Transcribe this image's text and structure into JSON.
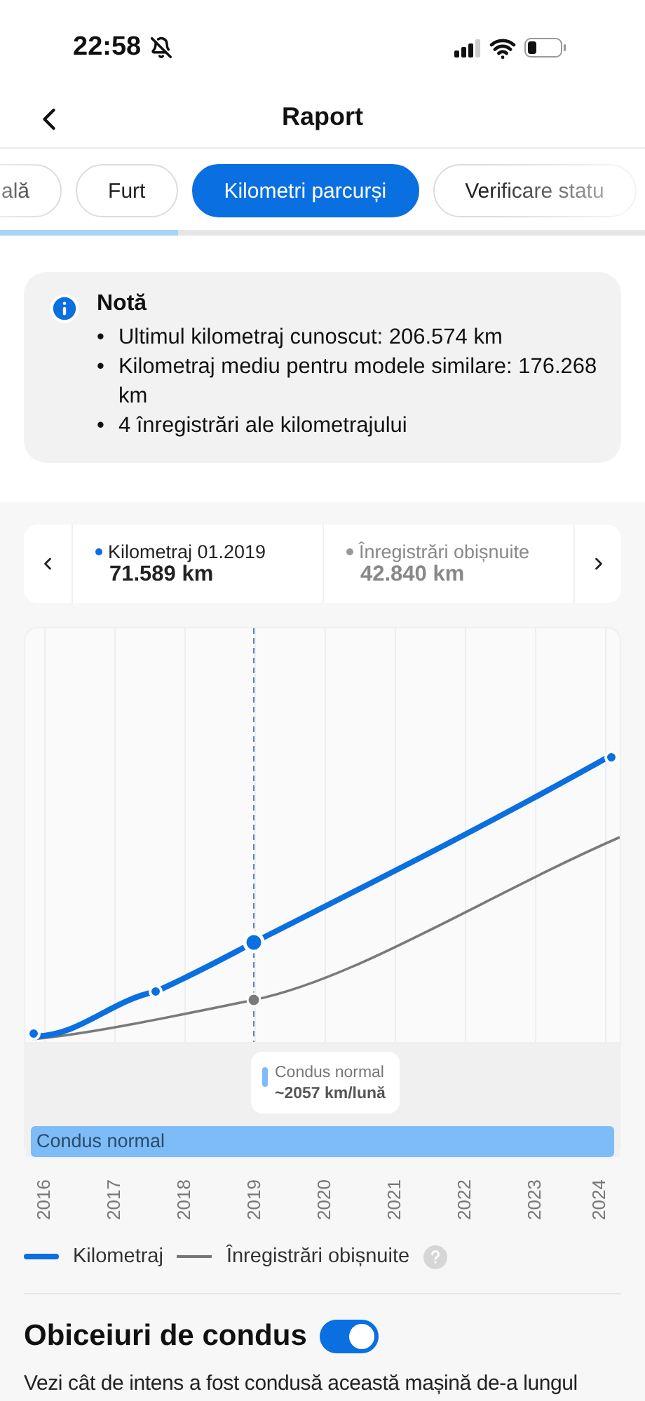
{
  "status_bar": {
    "time": "22:58"
  },
  "header": {
    "title": "Raport"
  },
  "tabs": [
    {
      "label": "ală",
      "selected": false
    },
    {
      "label": "Furt",
      "selected": false
    },
    {
      "label": "Kilometri parcurși",
      "selected": true
    },
    {
      "label": "Verificare statu",
      "selected": false
    }
  ],
  "note": {
    "title": "Notă",
    "bullet": "•",
    "items": [
      "Ultimul kilometraj cunoscut: 206.574 km",
      "Kilometraj mediu pentru modele similare: 176.268 km",
      "4 înregistrări ale kilometrajului"
    ]
  },
  "selector": {
    "primary": {
      "label": "Kilometraj 01.2019",
      "value": "71.589 km"
    },
    "secondary": {
      "label": "Înregistrări obișnuite",
      "value": "42.840 km"
    }
  },
  "chart": {
    "tooltip": {
      "label": "Condus normal",
      "value": "~2057 km/lună"
    },
    "band": "Condus normal",
    "years": [
      "2016",
      "2017",
      "2018",
      "2019",
      "2020",
      "2021",
      "2022",
      "2023",
      "2024"
    ]
  },
  "legend": [
    {
      "label": "Kilometraj",
      "kind": "main"
    },
    {
      "label": "Înregistrări obișnuite",
      "kind": "reference"
    }
  ],
  "driving_habits": {
    "title": "Obiceiuri de condus",
    "on": true,
    "text": "Vezi cât de intens a fost condusă această mașină de-a lungul"
  }
}
